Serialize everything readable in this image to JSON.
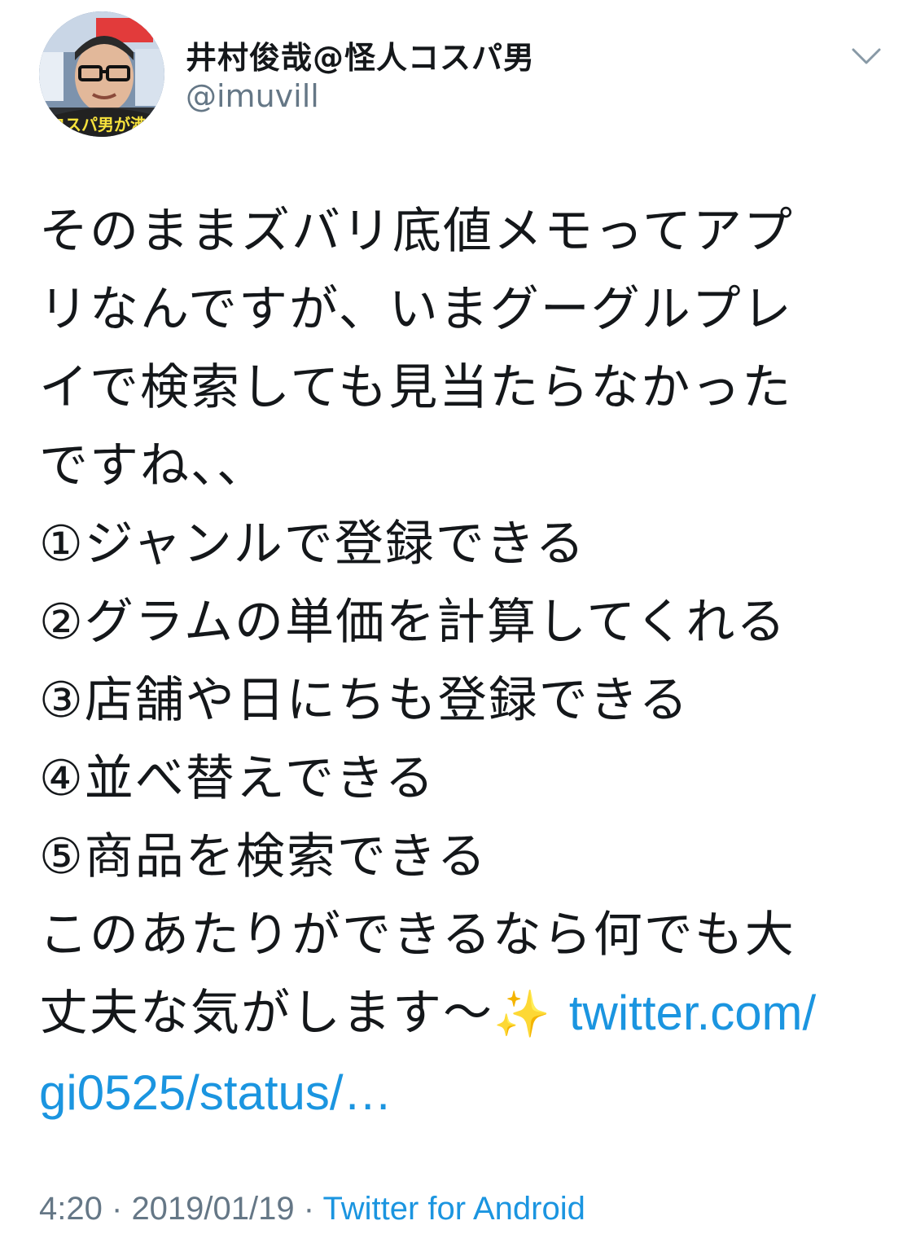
{
  "tweet": {
    "author": {
      "display_name": "井村俊哉@怪人コスパ男",
      "handle": "@imuvill",
      "avatar_caption": "コスパ男が沸騰！"
    },
    "menu_icon": "chevron-down-icon",
    "body": {
      "intro_lines": [
        "そのままズバリ底値メモってアプ",
        "リなんですが、いまグーグルプレ",
        "イで検索しても見当たらなかった",
        "ですね、、"
      ],
      "list_lines": [
        "①ジャンルで登録できる",
        "②グラムの単価を計算してくれる",
        "③店舗や日にちも登録できる",
        "④並べ替えできる",
        "⑤商品を検索できる"
      ],
      "closing_line_1": "このあたりができるなら何でも大",
      "closing_line_2_text": "丈夫な気がします〜",
      "sparkle_emoji": "✨",
      "link_part_1": "twitter.com/",
      "link_part_2": "gi0525/status/…"
    },
    "meta": {
      "time": "4:20",
      "separator": "·",
      "date": "2019/01/19",
      "source": "Twitter for Android"
    }
  },
  "colors": {
    "text": "#14171a",
    "secondary": "#657786",
    "link": "#1b95e0"
  }
}
